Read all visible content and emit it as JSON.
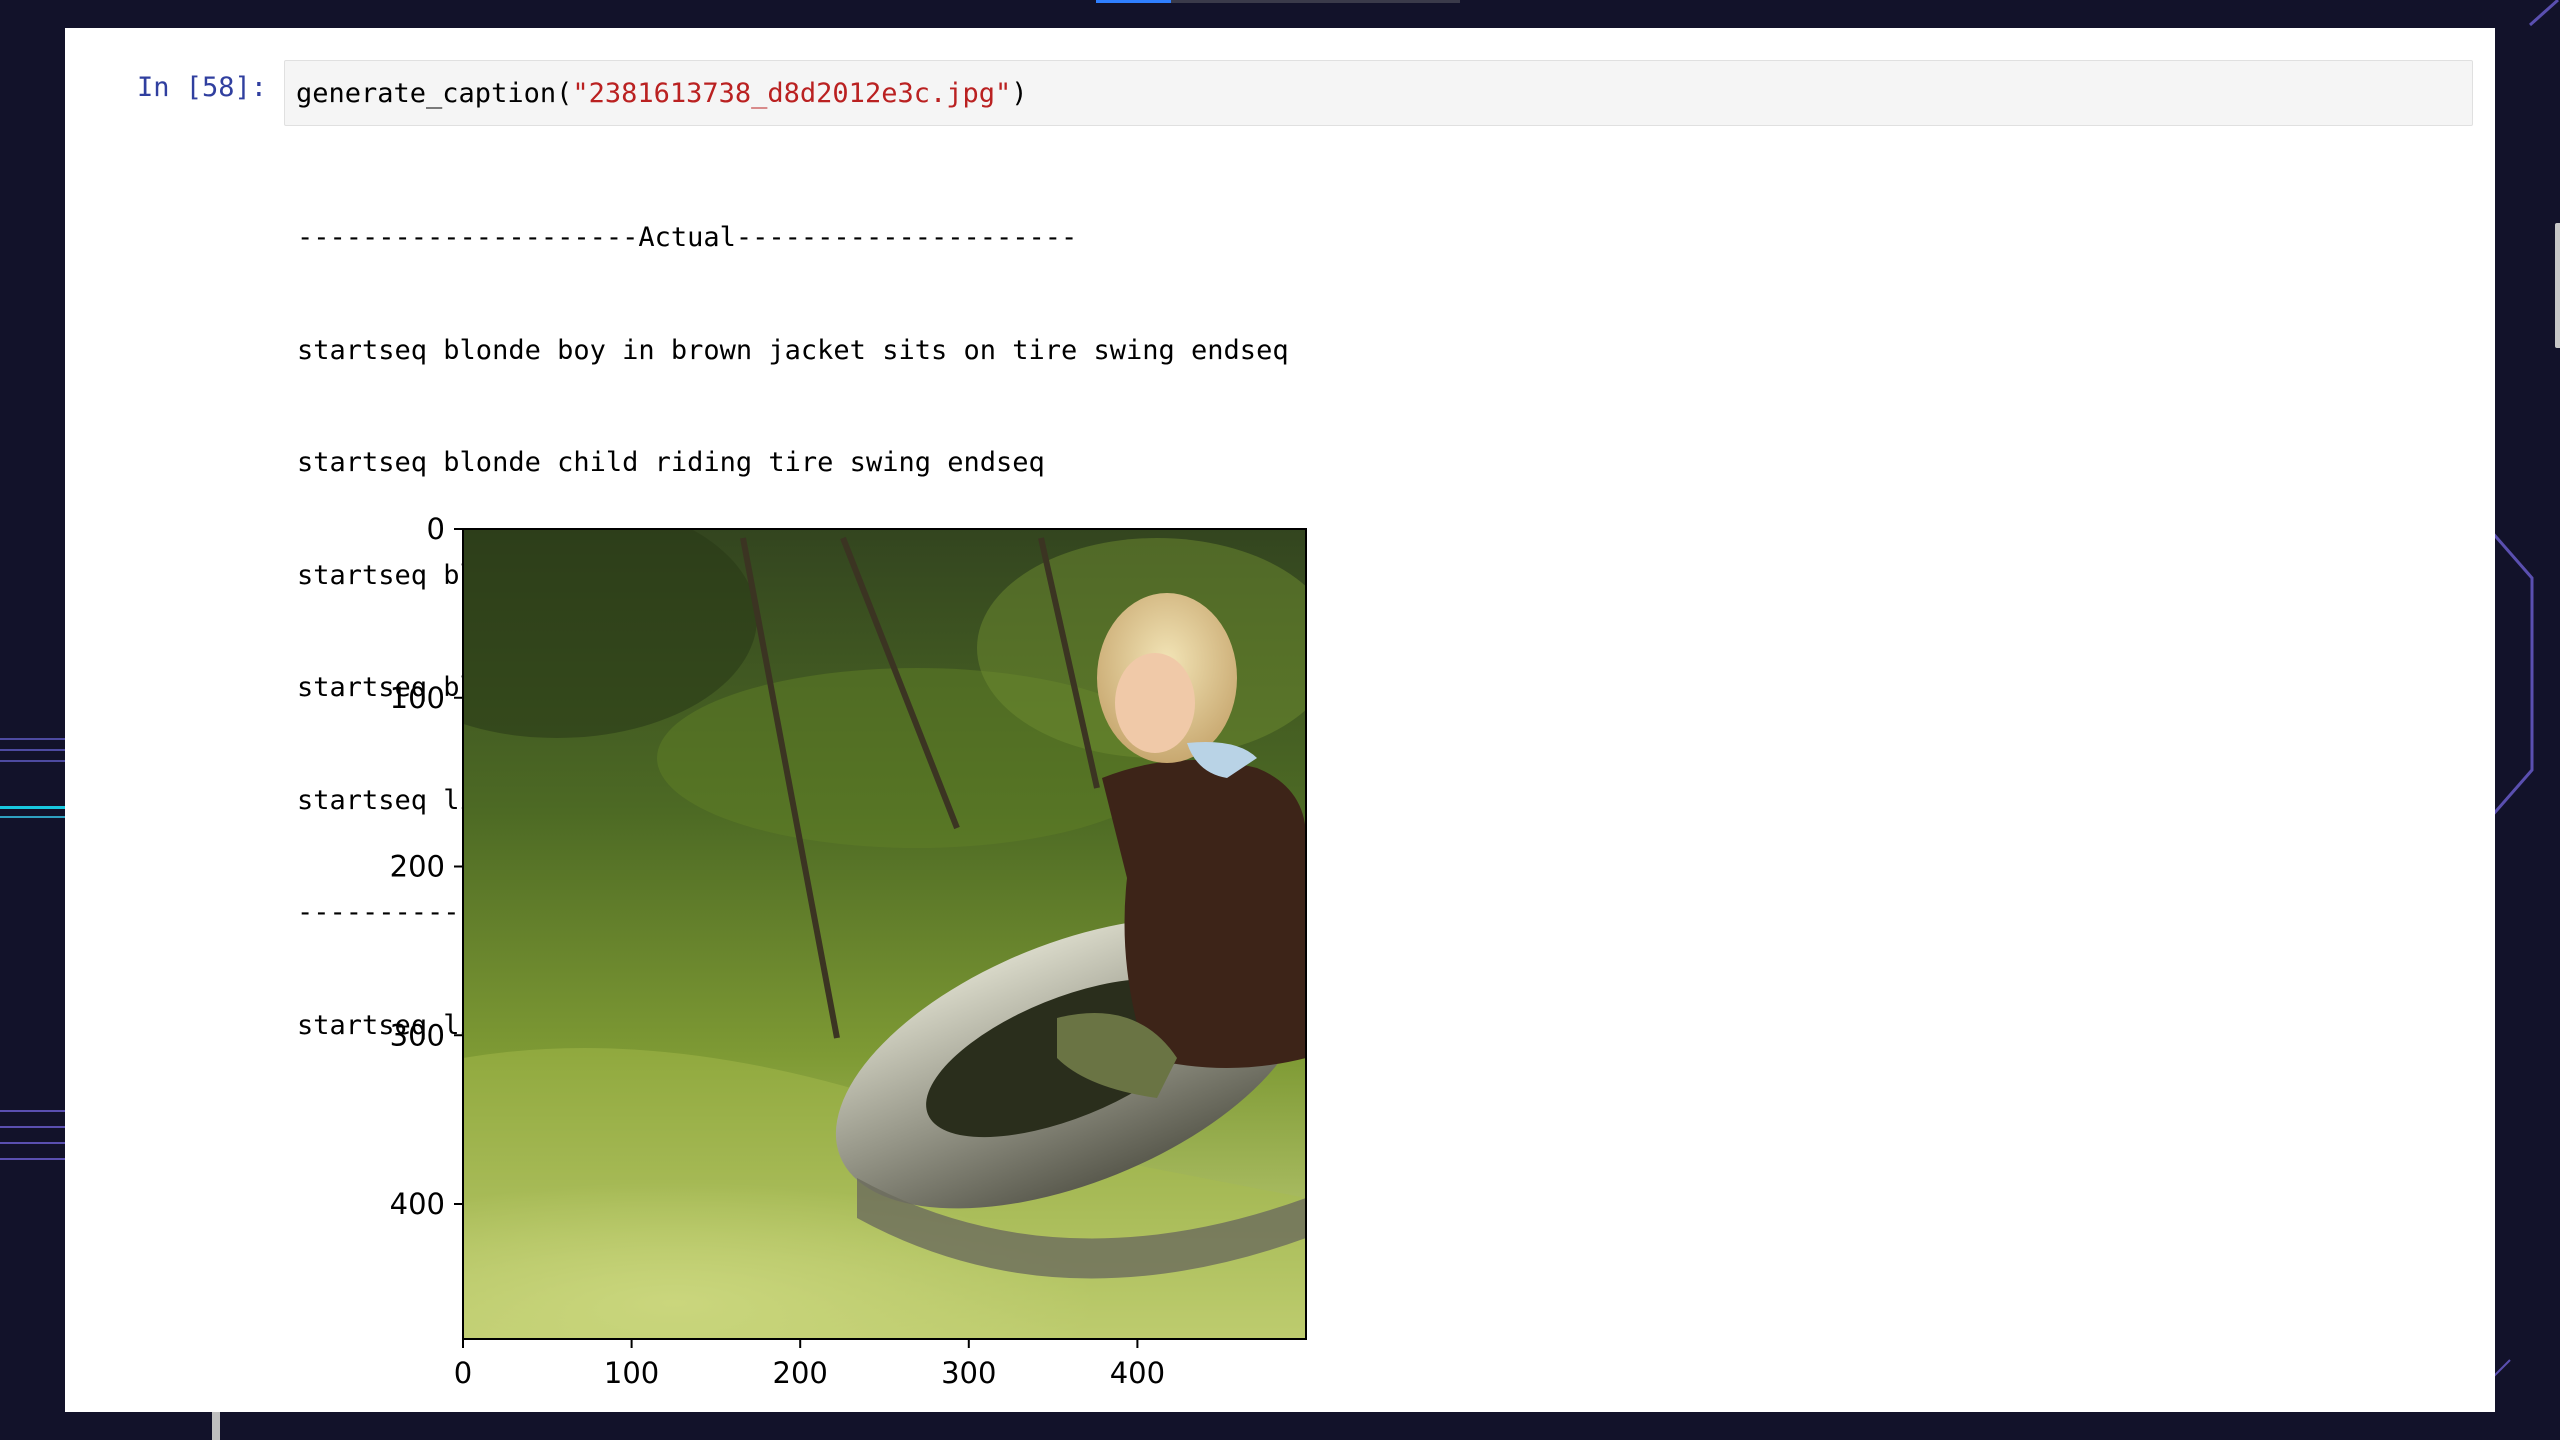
{
  "cell": {
    "prompt": "In [58]:",
    "code_func": "generate_caption(",
    "code_arg": "\"2381613738_d8d2012e3c.jpg\"",
    "code_close": ")"
  },
  "output": {
    "lines": [
      "---------------------Actual---------------------",
      "startseq blonde boy in brown jacket sits on tire swing endseq",
      "startseq blonde child riding tire swing endseq",
      "startseq blonde haired child is swinging on tire swing endseq",
      "startseq blonde haired toddler swinging on tire swing endseq",
      "startseq little boy swinging fast in tire swing endseq",
      "--------------------Predicted--------------------",
      "startseq little boy rides on swing endseq"
    ]
  },
  "figure": {
    "image_subject": "blonde toddler in brown jacket riding a tire swing on grass",
    "x_ticks": [
      "0",
      "100",
      "200",
      "300",
      "400"
    ],
    "y_ticks": [
      "0",
      "100",
      "200",
      "300",
      "400"
    ],
    "x_range": [
      0,
      500
    ],
    "y_range": [
      0,
      480
    ]
  },
  "colors": {
    "background": "#12122a",
    "notebook_bg": "#ffffff",
    "prompt": "#303f9f",
    "string_literal": "#ba2121",
    "accent_cyan": "#18c8e0",
    "accent_purple": "#4d4aa0"
  }
}
